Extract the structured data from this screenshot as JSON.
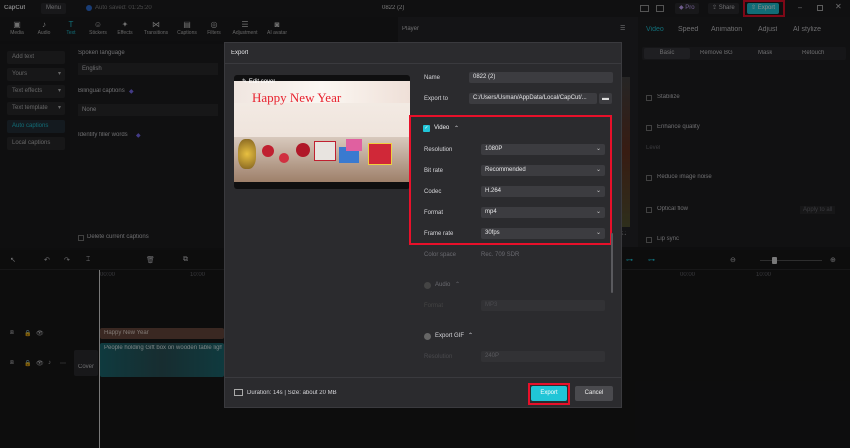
{
  "app": {
    "name": "CapCut",
    "menu_label": "Menu",
    "autosave": "Auto saved: 01:25:20",
    "project_title": "0822 (2)",
    "pro_label": "Pro",
    "share_label": "Share",
    "export_label": "Export"
  },
  "toolbar": {
    "items": [
      {
        "label": "Media",
        "icon": "media-icon"
      },
      {
        "label": "Audio",
        "icon": "audio-icon"
      },
      {
        "label": "Text",
        "icon": "text-icon"
      },
      {
        "label": "Stickers",
        "icon": "sticker-icon"
      },
      {
        "label": "Effects",
        "icon": "effects-icon"
      },
      {
        "label": "Transitions",
        "icon": "transitions-icon"
      },
      {
        "label": "Captions",
        "icon": "captions-icon"
      },
      {
        "label": "Filters",
        "icon": "filters-icon"
      },
      {
        "label": "Adjustment",
        "icon": "adjustment-icon"
      },
      {
        "label": "AI avatar",
        "icon": "avatar-icon"
      }
    ],
    "active": "Text"
  },
  "left_panel": {
    "items": [
      "Add text",
      "Yours",
      "Text effects",
      "Text template",
      "Auto captions",
      "Local captions"
    ],
    "active": "Auto captions"
  },
  "text_panel": {
    "spoken_language_label": "Spoken language",
    "spoken_language_value": "English",
    "bilingual_label": "Bilingual captions",
    "bilingual_value": "None",
    "filler_label": "Identify filler words",
    "delete_label": "Delete current captions"
  },
  "player": {
    "label": "Player"
  },
  "right_panel": {
    "tabs": [
      "Video",
      "Speed",
      "Animation",
      "Adjust",
      "AI stylize"
    ],
    "subtabs": [
      "Basic",
      "Remove BG",
      "Mask",
      "Retouch"
    ],
    "options": [
      "Stabilize",
      "Enhance quality",
      "Reduce image noise",
      "Optical flow",
      "Lip sync"
    ],
    "level_label": "Level",
    "apply_label": "Apply to all"
  },
  "timeline": {
    "track1_clip": "Happy New Year",
    "track2_clip": "People holding Gift box on wooden table lighting",
    "cover_label": "Cover",
    "time_marks": [
      "00:00",
      "10:00",
      "00:00",
      "10:00"
    ]
  },
  "export_dialog": {
    "title": "Export",
    "edit_cover_label": "Edit cover",
    "preview_text": "Happy New Year",
    "name_label": "Name",
    "name_value": "0822 (2)",
    "export_to_label": "Export to",
    "export_to_value": "C:/Users/Usman/AppData/Local/CapCut/...",
    "video_section_label": "Video",
    "resolution_label": "Resolution",
    "resolution_value": "1080P",
    "bitrate_label": "Bit rate",
    "bitrate_value": "Recommended",
    "codec_label": "Codec",
    "codec_value": "H.264",
    "format_label": "Format",
    "format_value": "mp4",
    "framerate_label": "Frame rate",
    "framerate_value": "30fps",
    "color_space_label": "Color space",
    "color_space_value": "Rec. 709 SDR",
    "audio_section_label": "Audio",
    "audio_format_label": "Format",
    "audio_format_value": "MP3",
    "gif_section_label": "Export GIF",
    "gif_resolution_label": "Resolution",
    "gif_resolution_value": "240P",
    "duration_text": "Duration: 14s | Size: about 20 MB",
    "export_button": "Export",
    "cancel_button": "Cancel"
  },
  "colors": {
    "accent": "#20c5d7",
    "highlight": "#e8102a",
    "preview_text": "#e8232f"
  }
}
